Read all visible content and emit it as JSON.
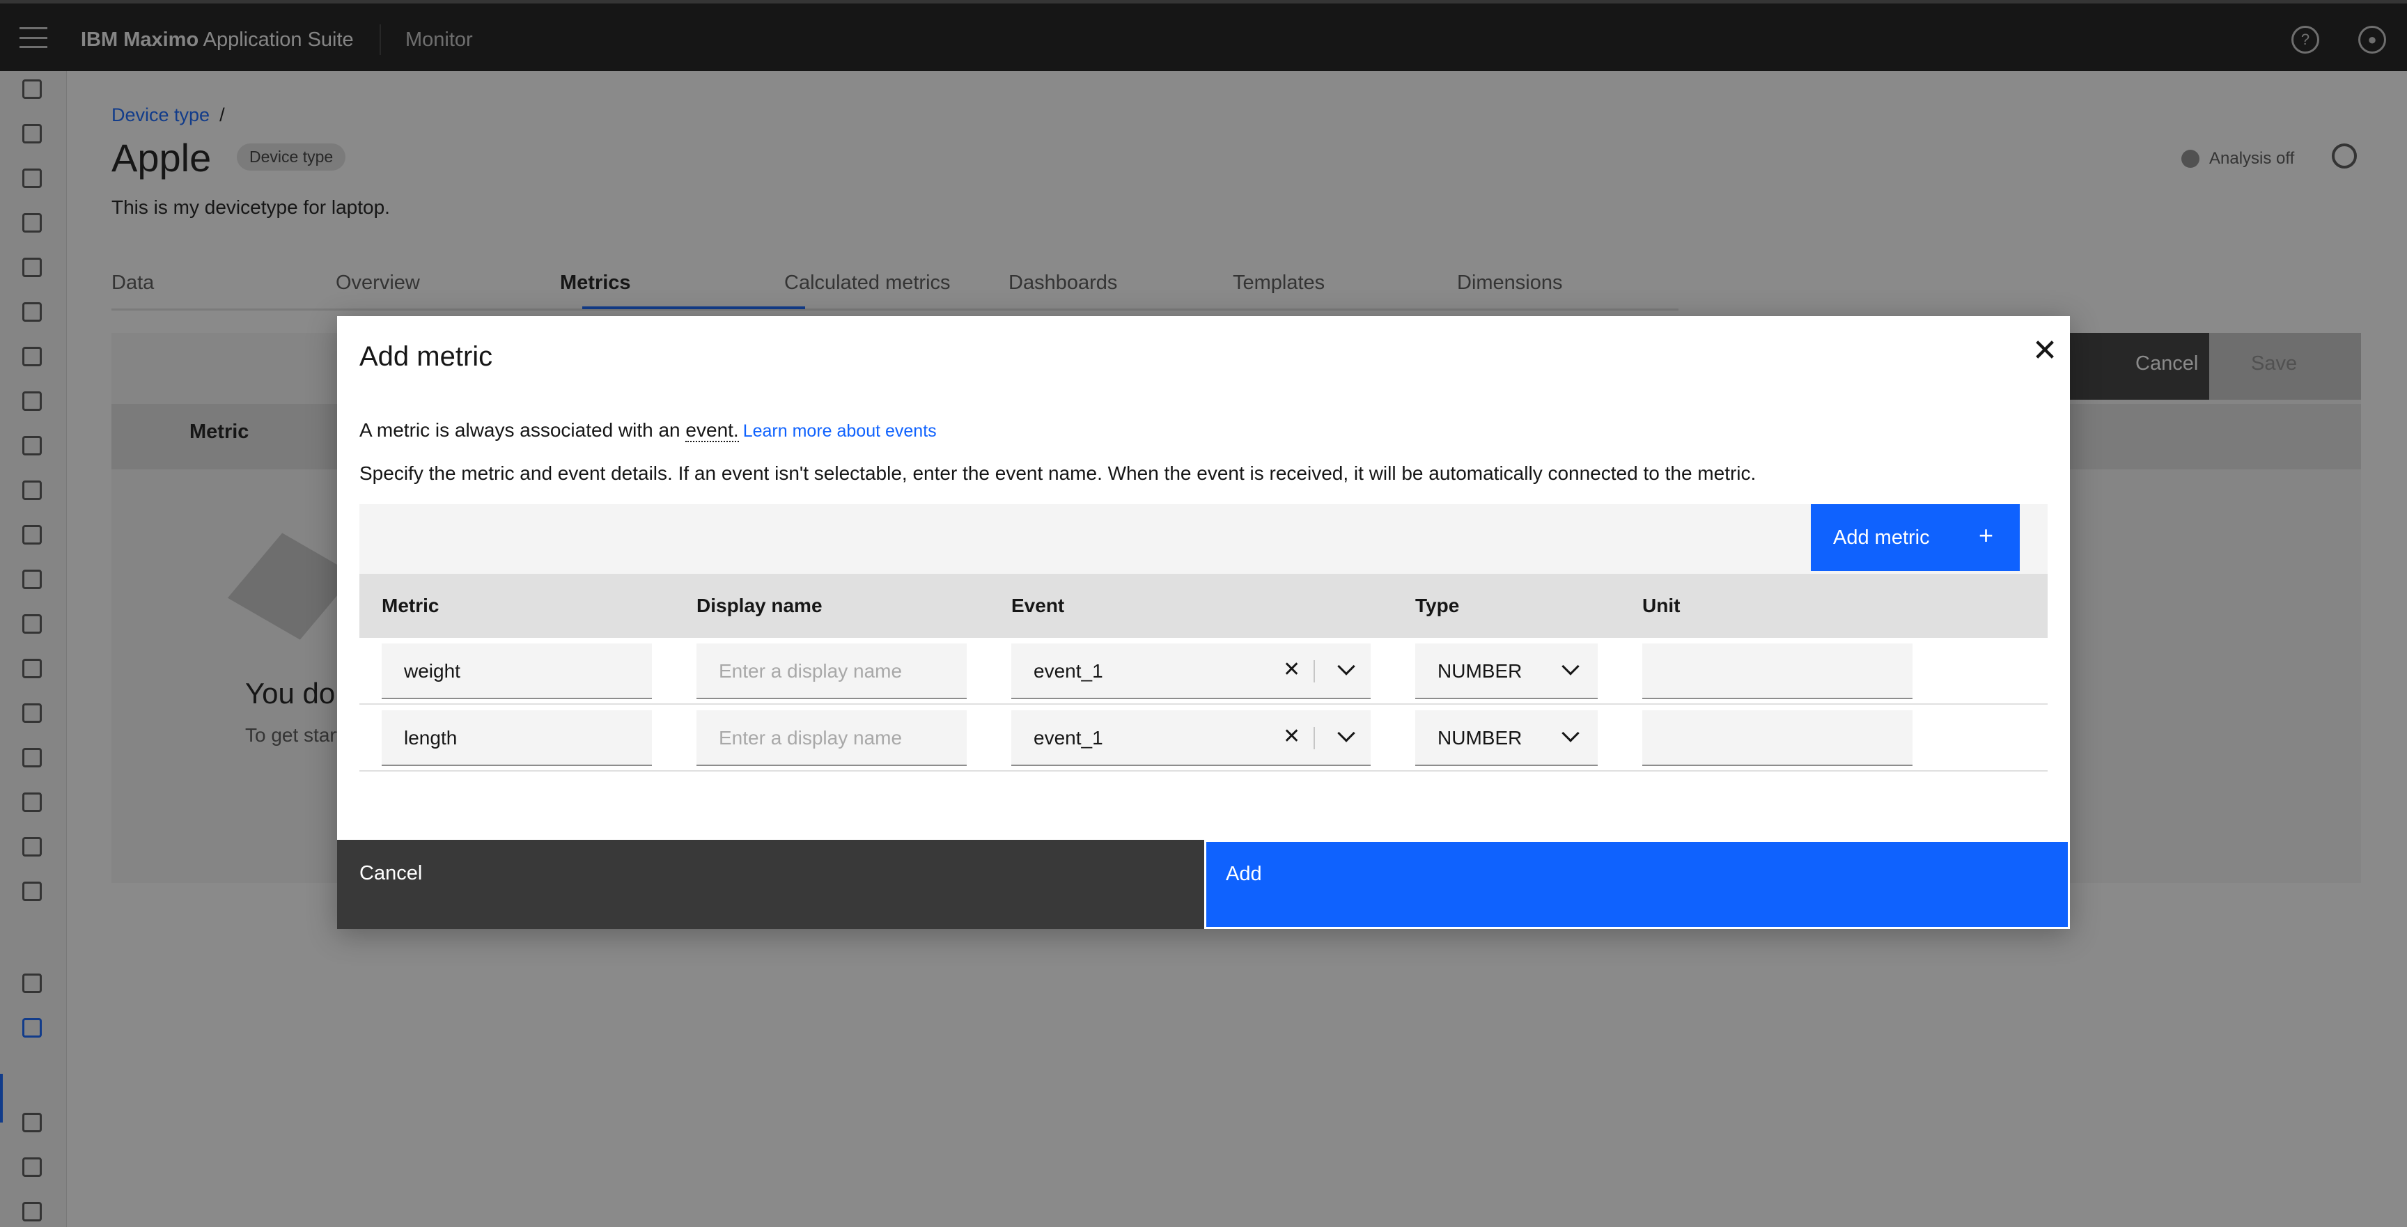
{
  "topbar": {
    "brand_bold": "IBM Maximo",
    "brand_rest": " Application Suite",
    "app_name": "Monitor",
    "help_icon": "help-icon",
    "user_icon": "user-avatar-icon"
  },
  "page": {
    "breadcrumb": "Device type",
    "breadcrumb_sep": "/",
    "title": "Apple",
    "tag": "Device type",
    "description": "This is my devicetype for laptop.",
    "analysis": "Analysis off",
    "tabs": [
      "Data",
      "Overview",
      "Metrics",
      "Calculated metrics",
      "Dashboards",
      "Templates",
      "Dimensions"
    ],
    "active_tab": "Metrics",
    "bg_cancel": "Cancel",
    "bg_save": "Save",
    "bg_col_metric": "Metric",
    "empty_title": "You don't have any metrics",
    "empty_sub": "To get started, add a metric."
  },
  "modal": {
    "title": "Add metric",
    "intro_prefix": "A metric is always associated with an ",
    "intro_event": "event.",
    "learn_more": "Learn more about events",
    "spec": "Specify the metric and event details. If an event isn't selectable, enter the event name. When the event is received, it will be automatically connected to the metric.",
    "add_metric_label": "Add metric",
    "add_metric_plus": "+",
    "columns": {
      "metric": "Metric",
      "display_name": "Display name",
      "event": "Event",
      "type": "Type",
      "unit": "Unit"
    },
    "rows": [
      {
        "metric": "weight",
        "display_placeholder": "Enter a display name",
        "event": "event_1",
        "type": "NUMBER",
        "unit": ""
      },
      {
        "metric": "length",
        "display_placeholder": "Enter a display name",
        "event": "event_1",
        "type": "NUMBER",
        "unit": ""
      }
    ],
    "cancel_label": "Cancel",
    "add_label": "Add"
  }
}
